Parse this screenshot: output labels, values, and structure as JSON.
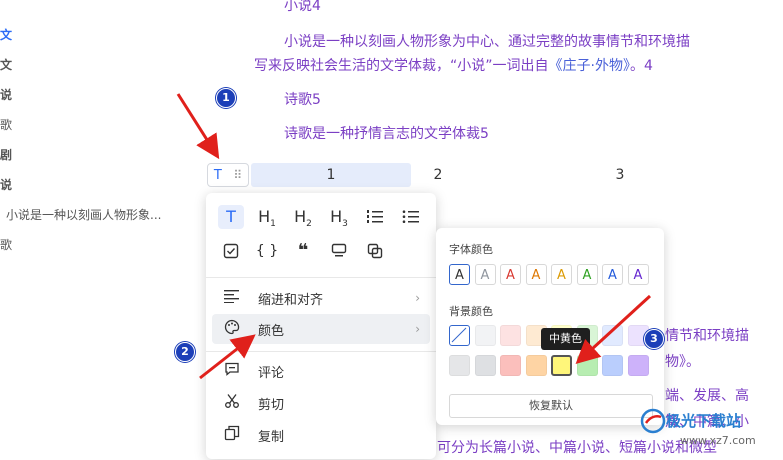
{
  "sidebar": {
    "items": [
      {
        "label": "文",
        "style": "active"
      },
      {
        "label": "文",
        "style": "bold"
      },
      {
        "label": "说",
        "style": "bold"
      },
      {
        "label": "歌",
        "style": "normal"
      },
      {
        "label": "剧",
        "style": "bold"
      },
      {
        "label": "说",
        "style": "bold"
      },
      {
        "label": "小说是一种以刻画人物形象...",
        "style": "normal"
      },
      {
        "label": "歌",
        "style": "normal"
      }
    ]
  },
  "doc": {
    "heading_novel": "小说4",
    "novel_para_line1": "小说是一种以刻画人物形象为中心、通过完整的故事情节和环境描",
    "novel_para_line2_a": "写来反映社会生活的文学体裁，“小说”一词出自",
    "novel_para_line2_em": "《庄子·外物》",
    "novel_para_line2_b": "。4",
    "heading_poem": "诗歌5",
    "poem_para": "诗歌是一种抒情言志的文学体裁5",
    "partial_right_1": "情节和环境描",
    "partial_right_2": "物》。",
    "partial_right_3": "端、发展、高",
    "partial_right_4": "篇、中篇、小",
    "partial_bottom": "可分为长篇小说、中篇小说、短篇小说和微型"
  },
  "table": {
    "cells": [
      "1",
      "2",
      "3"
    ]
  },
  "block_handle": {
    "type_icon": "T",
    "grip_icon": "⠿"
  },
  "menu": {
    "tools_row1": [
      "T",
      "H1",
      "H2",
      "H3",
      "numbered-list",
      "bullet-list"
    ],
    "tools_row2": [
      "checkbox",
      "{ }",
      "❝",
      "callout",
      "link-card"
    ],
    "items": [
      {
        "icon": "align-icon",
        "label": "缩进和对齐",
        "submenu": true
      },
      {
        "icon": "palette-icon",
        "label": "颜色",
        "submenu": true
      },
      {
        "icon": "comment-icon",
        "label": "评论",
        "submenu": false
      },
      {
        "icon": "scissors-icon",
        "label": "剪切",
        "submenu": false
      },
      {
        "icon": "copy-icon",
        "label": "复制",
        "submenu": false
      }
    ]
  },
  "color_panel": {
    "font_color_title": "字体颜色",
    "font_colors": [
      "#333333",
      "#8f959e",
      "#d83931",
      "#de7802",
      "#dc9b04",
      "#2ea121",
      "#245bdb",
      "#6425d0"
    ],
    "font_letter": "A",
    "bg_color_title": "背景颜色",
    "bg_row1": [
      "none",
      "#f2f3f5",
      "#fde2e2",
      "#feead2",
      "#ffffcc",
      "#d9f5d6",
      "#e1eaff",
      "#ece2fe"
    ],
    "bg_row2": [
      "#e5e6e8",
      "#dee0e3",
      "#fbbfbc",
      "#fed4a4",
      "#fff67a",
      "#b7edb1",
      "#bacefd",
      "#cdb2fa"
    ],
    "hovered_tooltip": "中黄色",
    "reset_label": "恢复默认"
  },
  "badges": [
    "1",
    "2",
    "3"
  ],
  "watermark": {
    "text": "极光下载站",
    "url": "www.xz7.com"
  }
}
